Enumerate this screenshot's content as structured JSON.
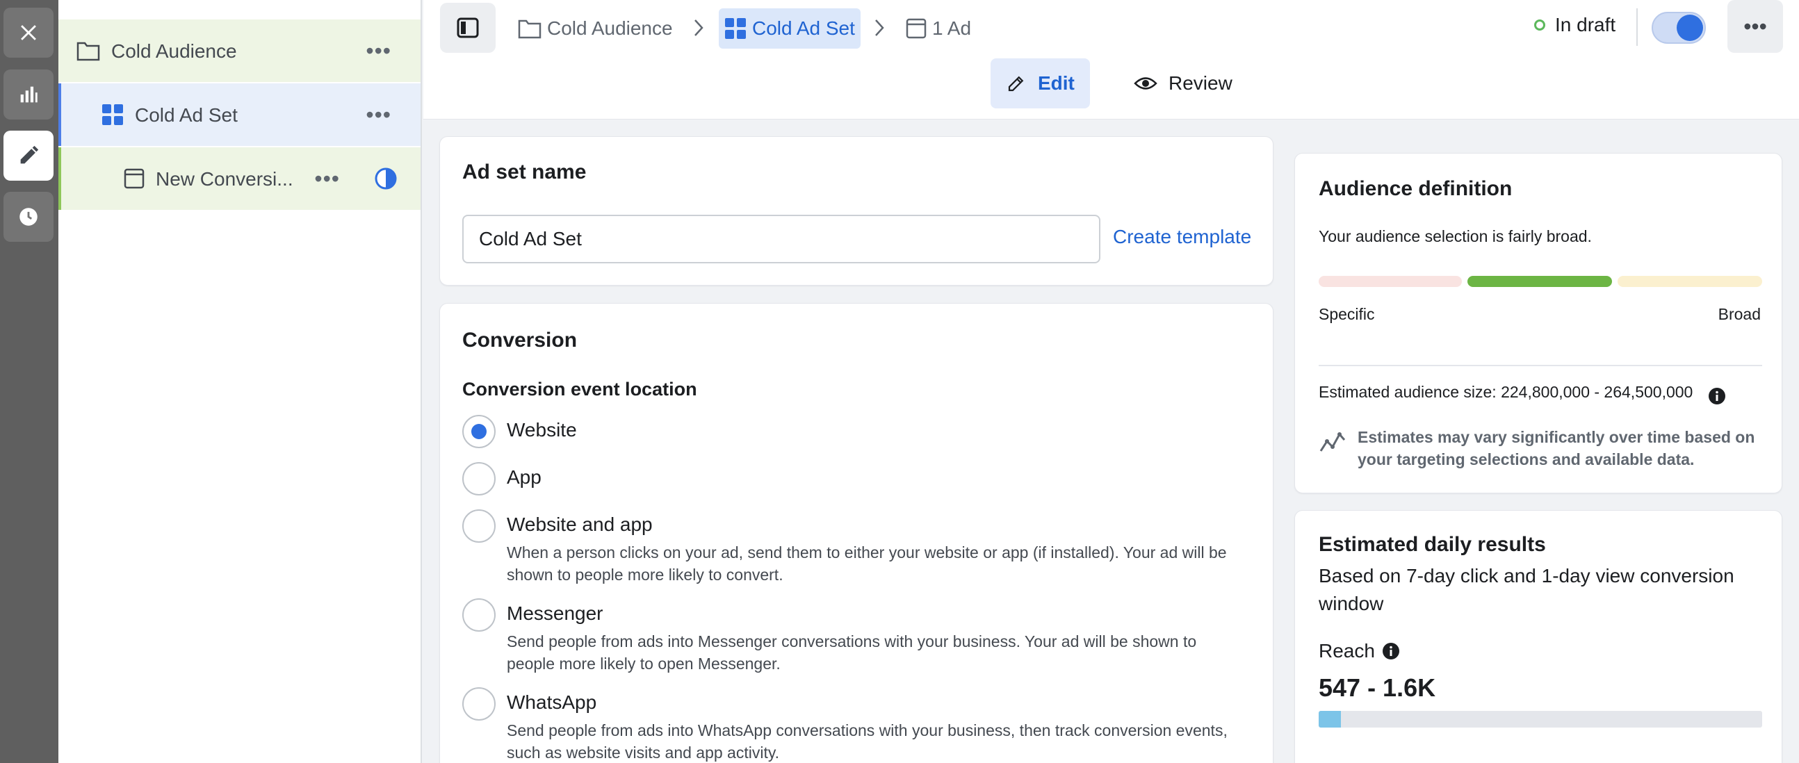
{
  "rail": {
    "close": "close-icon",
    "reports": "bar-chart-icon",
    "edit": "pencil-icon",
    "history": "clock-icon"
  },
  "tree": {
    "campaign": {
      "label": "Cold Audience",
      "icon": "folder-icon"
    },
    "adset": {
      "label": "Cold Ad Set",
      "icon": "grid-icon"
    },
    "ad": {
      "label": "New Conversi...",
      "icon": "ad-frame-icon",
      "status_icon": "half-circle-icon"
    }
  },
  "header": {
    "breadcrumbs": [
      "Cold Audience",
      "Cold Ad Set",
      "1 Ad"
    ],
    "status": "In draft",
    "toggle_on": true,
    "tabs": {
      "edit": "Edit",
      "review": "Review"
    }
  },
  "adset_name": {
    "title": "Ad set name",
    "value": "Cold Ad Set",
    "template_link": "Create template"
  },
  "conversion": {
    "title": "Conversion",
    "location_label": "Conversion event location",
    "options": [
      {
        "label": "Website",
        "desc": "",
        "checked": true
      },
      {
        "label": "App",
        "desc": "",
        "checked": false
      },
      {
        "label": "Website and app",
        "desc": "When a person clicks on your ad, send them to either your website or app (if installed). Your ad will be shown to people more likely to convert.",
        "checked": false
      },
      {
        "label": "Messenger",
        "desc": "Send people from ads into Messenger conversations with your business. Your ad will be shown to people more likely to open Messenger.",
        "checked": false
      },
      {
        "label": "WhatsApp",
        "desc": "Send people from ads into WhatsApp conversations with your business, then track conversion events, such as website visits and app activity.",
        "checked": false
      }
    ]
  },
  "audience": {
    "title": "Audience definition",
    "summary": "Your audience selection is fairly broad.",
    "meter_colors": [
      "#f9e3e1",
      "#6cb544",
      "#fbf0cf"
    ],
    "specific_label": "Specific",
    "broad_label": "Broad",
    "size_label": "Estimated audience size:",
    "size_value": "224,800,000 - 264,500,000",
    "note": "Estimates may vary significantly over time based on your targeting selections and available data."
  },
  "daily": {
    "title": "Estimated daily results",
    "subtitle": "Based on 7-day click and 1-day view conversion window",
    "reach_label": "Reach",
    "reach_value": "547 - 1.6K",
    "reach_fill_percent": 5
  },
  "colors": {
    "accent": "#1f63d1",
    "radio": "#2f6fe0",
    "bar_fill": "#7cc4e8"
  }
}
